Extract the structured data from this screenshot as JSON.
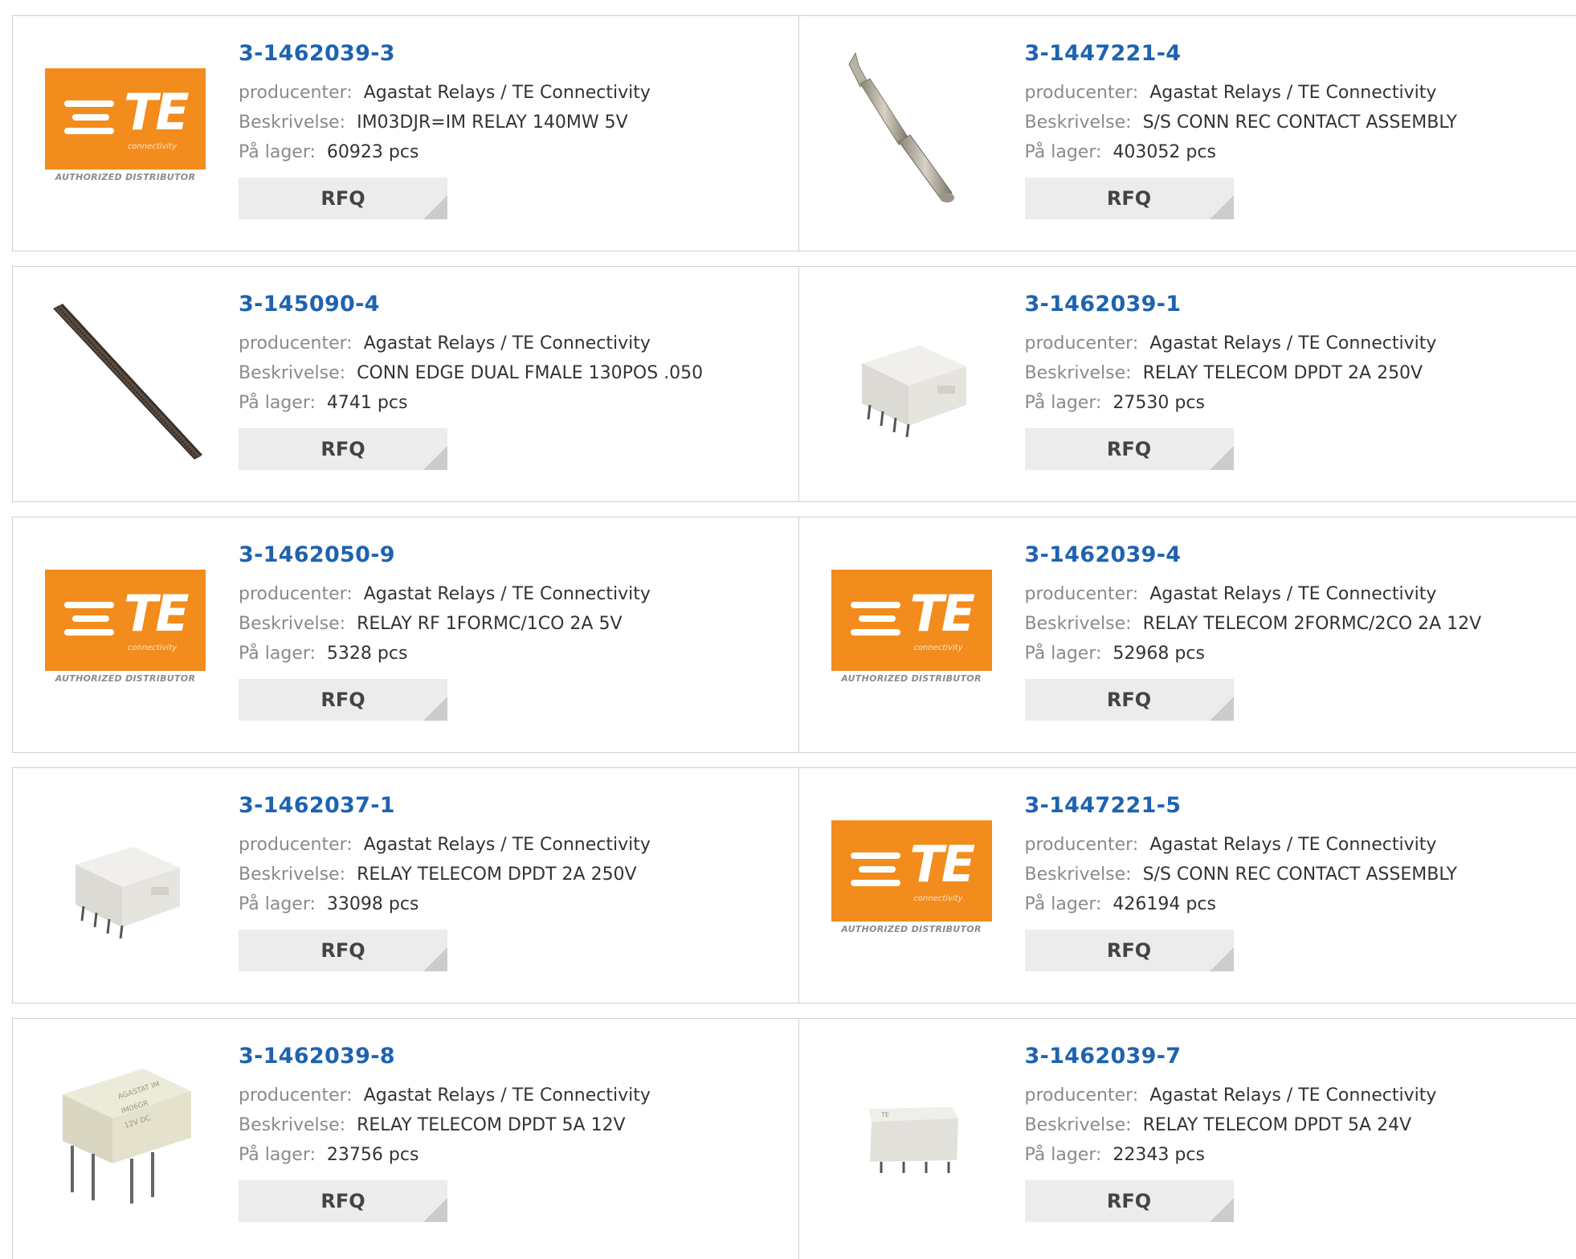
{
  "labels": {
    "manufacturer": "producenter:",
    "description": "Beskrivelse:",
    "stock": "På lager:",
    "rfq": "RFQ"
  },
  "logo": {
    "brand": "TE",
    "sub": "connectivity",
    "authorized": "AUTHORIZED DISTRIBUTOR",
    "color": "#f28c1d"
  },
  "products": [
    {
      "part": "3-1462039-3",
      "manufacturer": "Agastat Relays / TE Connectivity",
      "description": "IM03DJR=IM RELAY 140MW 5V",
      "stock": "60923 pcs",
      "image": "te-logo"
    },
    {
      "part": "3-1447221-4",
      "manufacturer": "Agastat Relays / TE Connectivity",
      "description": "S/S CONN REC CONTACT ASSEMBLY",
      "stock": "403052 pcs",
      "image": "contact-pin"
    },
    {
      "part": "3-145090-4",
      "manufacturer": "Agastat Relays / TE Connectivity",
      "description": "CONN EDGE DUAL FMALE 130POS .050",
      "stock": "4741 pcs",
      "image": "edge-connector"
    },
    {
      "part": "3-1462039-1",
      "manufacturer": "Agastat Relays / TE Connectivity",
      "description": "RELAY TELECOM DPDT 2A 250V",
      "stock": "27530 pcs",
      "image": "smd-relay"
    },
    {
      "part": "3-1462050-9",
      "manufacturer": "Agastat Relays / TE Connectivity",
      "description": "RELAY RF 1FORMC/1CO 2A 5V",
      "stock": "5328 pcs",
      "image": "te-logo"
    },
    {
      "part": "3-1462039-4",
      "manufacturer": "Agastat Relays / TE Connectivity",
      "description": "RELAY TELECOM 2FORMC/2CO 2A 12V",
      "stock": "52968 pcs",
      "image": "te-logo"
    },
    {
      "part": "3-1462037-1",
      "manufacturer": "Agastat Relays / TE Connectivity",
      "description": "RELAY TELECOM DPDT 2A 250V",
      "stock": "33098 pcs",
      "image": "smd-relay"
    },
    {
      "part": "3-1447221-5",
      "manufacturer": "Agastat Relays / TE Connectivity",
      "description": "S/S CONN REC CONTACT ASSEMBLY",
      "stock": "426194 pcs",
      "image": "te-logo"
    },
    {
      "part": "3-1462039-8",
      "manufacturer": "Agastat Relays / TE Connectivity",
      "description": "RELAY TELECOM DPDT 5A 12V",
      "stock": "23756 pcs",
      "image": "tht-relay"
    },
    {
      "part": "3-1462039-7",
      "manufacturer": "Agastat Relays / TE Connectivity",
      "description": "RELAY TELECOM DPDT 5A 24V",
      "stock": "22343 pcs",
      "image": "smd-relay-small"
    }
  ]
}
